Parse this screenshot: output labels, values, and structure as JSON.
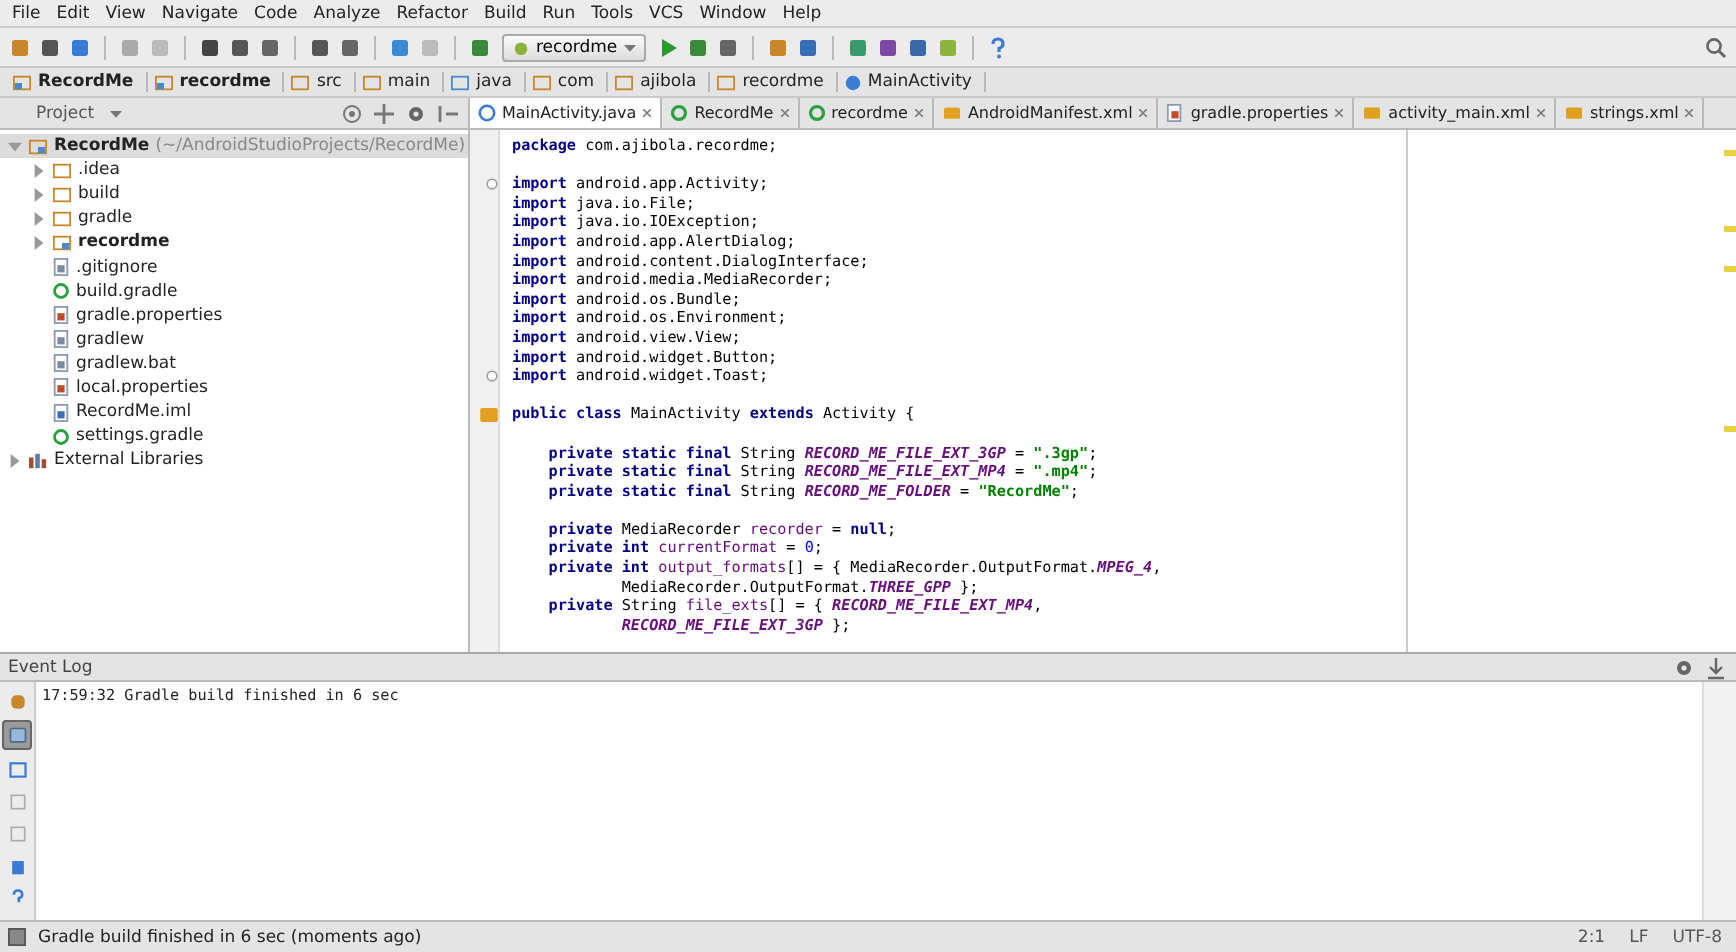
{
  "menu": [
    "File",
    "Edit",
    "View",
    "Navigate",
    "Code",
    "Analyze",
    "Refactor",
    "Build",
    "Run",
    "Tools",
    "VCS",
    "Window",
    "Help"
  ],
  "toolbar": {
    "run_config": "recordme"
  },
  "breadcrumbs": [
    {
      "label": "RecordMe",
      "kind": "module",
      "bold": true
    },
    {
      "label": "recordme",
      "kind": "module",
      "bold": true
    },
    {
      "label": "src",
      "kind": "folder",
      "bold": false
    },
    {
      "label": "main",
      "kind": "folder",
      "bold": false
    },
    {
      "label": "java",
      "kind": "source",
      "bold": false
    },
    {
      "label": "com",
      "kind": "package",
      "bold": false
    },
    {
      "label": "ajibola",
      "kind": "package",
      "bold": false
    },
    {
      "label": "recordme",
      "kind": "package",
      "bold": false
    },
    {
      "label": "MainActivity",
      "kind": "class",
      "bold": false
    }
  ],
  "project_panel": {
    "title": "Project",
    "tree": [
      {
        "label": "RecordMe",
        "note": "(~/AndroidStudioProjects/RecordMe)",
        "kind": "module",
        "bold": true,
        "expanded": true,
        "selected": true,
        "children": [
          {
            "label": ".idea",
            "kind": "folder",
            "bold": false,
            "expanded": false,
            "selected": false
          },
          {
            "label": "build",
            "kind": "folder",
            "bold": false,
            "expanded": false,
            "selected": false
          },
          {
            "label": "gradle",
            "kind": "folder",
            "bold": false,
            "expanded": false,
            "selected": false
          },
          {
            "label": "recordme",
            "kind": "module",
            "bold": true,
            "expanded": false,
            "selected": false
          },
          {
            "label": ".gitignore",
            "kind": "text",
            "bold": false,
            "selected": false
          },
          {
            "label": "build.gradle",
            "kind": "gradle",
            "bold": false,
            "selected": false
          },
          {
            "label": "gradle.properties",
            "kind": "props",
            "bold": false,
            "selected": false
          },
          {
            "label": "gradlew",
            "kind": "text",
            "bold": false,
            "selected": false
          },
          {
            "label": "gradlew.bat",
            "kind": "text",
            "bold": false,
            "selected": false
          },
          {
            "label": "local.properties",
            "kind": "props",
            "bold": false,
            "selected": false
          },
          {
            "label": "RecordMe.iml",
            "kind": "iml",
            "bold": false,
            "selected": false
          },
          {
            "label": "settings.gradle",
            "kind": "gradle",
            "bold": false,
            "selected": false
          }
        ]
      },
      {
        "label": "External Libraries",
        "kind": "libs",
        "bold": false,
        "expanded": false,
        "selected": false
      }
    ]
  },
  "editor_tabs": [
    {
      "label": "MainActivity.java",
      "kind": "class",
      "selected": true
    },
    {
      "label": "RecordMe",
      "kind": "gradle",
      "selected": false
    },
    {
      "label": "recordme",
      "kind": "gradle",
      "selected": false
    },
    {
      "label": "AndroidManifest.xml",
      "kind": "xml",
      "selected": false
    },
    {
      "label": "gradle.properties",
      "kind": "props",
      "selected": false
    },
    {
      "label": "activity_main.xml",
      "kind": "xml",
      "selected": false
    },
    {
      "label": "strings.xml",
      "kind": "xml",
      "selected": false
    }
  ],
  "code": [
    {
      "segments": [
        {
          "text": "package",
          "kind": "keyword"
        },
        {
          "text": " com.ajibola.recordme;",
          "kind": "plain"
        }
      ]
    },
    {
      "space_before": true,
      "fold": true,
      "segments": [
        {
          "text": "import",
          "kind": "keyword"
        },
        {
          "text": " android.app.Activity;",
          "kind": "plain"
        }
      ]
    },
    {
      "segments": [
        {
          "text": "import",
          "kind": "keyword"
        },
        {
          "text": " java.io.File;",
          "kind": "plain"
        }
      ]
    },
    {
      "segments": [
        {
          "text": "import",
          "kind": "keyword"
        },
        {
          "text": " java.io.IOException;",
          "kind": "plain"
        }
      ]
    },
    {
      "segments": [
        {
          "text": "import",
          "kind": "keyword"
        },
        {
          "text": " android.app.AlertDialog;",
          "kind": "plain"
        }
      ]
    },
    {
      "segments": [
        {
          "text": "import",
          "kind": "keyword"
        },
        {
          "text": " android.content.DialogInterface;",
          "kind": "plain"
        }
      ]
    },
    {
      "segments": [
        {
          "text": "import",
          "kind": "keyword"
        },
        {
          "text": " android.media.MediaRecorder;",
          "kind": "plain"
        }
      ]
    },
    {
      "segments": [
        {
          "text": "import",
          "kind": "keyword"
        },
        {
          "text": " android.os.Bundle;",
          "kind": "plain"
        }
      ]
    },
    {
      "segments": [
        {
          "text": "import",
          "kind": "keyword"
        },
        {
          "text": " android.os.Environment;",
          "kind": "plain"
        }
      ]
    },
    {
      "segments": [
        {
          "text": "import",
          "kind": "keyword"
        },
        {
          "text": " android.view.View;",
          "kind": "plain"
        }
      ]
    },
    {
      "segments": [
        {
          "text": "import",
          "kind": "keyword"
        },
        {
          "text": " android.widget.Button;",
          "kind": "plain"
        }
      ]
    },
    {
      "fold": true,
      "segments": [
        {
          "text": "import",
          "kind": "keyword"
        },
        {
          "text": " android.widget.Toast;",
          "kind": "plain"
        }
      ]
    },
    {
      "space_before": true,
      "marker": true,
      "segments": [
        {
          "text": "public class",
          "kind": "keyword"
        },
        {
          "text": " MainActivity ",
          "kind": "plain"
        },
        {
          "text": "extends",
          "kind": "keyword"
        },
        {
          "text": " Activity {",
          "kind": "plain"
        }
      ]
    },
    {
      "space_before": true,
      "segments": [
        {
          "text": "    private static final",
          "kind": "keyword"
        },
        {
          "text": " String ",
          "kind": "plain"
        },
        {
          "text": "RECORD_ME_FILE_EXT_3GP",
          "kind": "constant"
        },
        {
          "text": " = ",
          "kind": "plain"
        },
        {
          "text": "\".3gp\"",
          "kind": "string"
        },
        {
          "text": ";",
          "kind": "plain"
        }
      ]
    },
    {
      "segments": [
        {
          "text": "    private static final",
          "kind": "keyword"
        },
        {
          "text": " String ",
          "kind": "plain"
        },
        {
          "text": "RECORD_ME_FILE_EXT_MP4",
          "kind": "constant"
        },
        {
          "text": " = ",
          "kind": "plain"
        },
        {
          "text": "\".mp4\"",
          "kind": "string"
        },
        {
          "text": ";",
          "kind": "plain"
        }
      ]
    },
    {
      "segments": [
        {
          "text": "    private static final",
          "kind": "keyword"
        },
        {
          "text": " String ",
          "kind": "plain"
        },
        {
          "text": "RECORD_ME_FOLDER",
          "kind": "constant"
        },
        {
          "text": " = ",
          "kind": "plain"
        },
        {
          "text": "\"RecordMe\"",
          "kind": "string"
        },
        {
          "text": ";",
          "kind": "plain"
        }
      ]
    },
    {
      "space_before": true,
      "segments": [
        {
          "text": "    private",
          "kind": "keyword"
        },
        {
          "text": " MediaRecorder ",
          "kind": "plain"
        },
        {
          "text": "recorder",
          "kind": "field"
        },
        {
          "text": " = ",
          "kind": "plain"
        },
        {
          "text": "null",
          "kind": "keyword"
        },
        {
          "text": ";",
          "kind": "plain"
        }
      ]
    },
    {
      "segments": [
        {
          "text": "    private int ",
          "kind": "keyword"
        },
        {
          "text": "currentFormat",
          "kind": "field"
        },
        {
          "text": " = ",
          "kind": "plain"
        },
        {
          "text": "0",
          "kind": "number"
        },
        {
          "text": ";",
          "kind": "plain"
        }
      ]
    },
    {
      "segments": [
        {
          "text": "    private int ",
          "kind": "keyword"
        },
        {
          "text": "output_formats",
          "kind": "field"
        },
        {
          "text": "[] = { MediaRecorder.OutputFormat.",
          "kind": "plain"
        },
        {
          "text": "MPEG_4",
          "kind": "constant"
        },
        {
          "text": ",",
          "kind": "plain"
        }
      ]
    },
    {
      "segments": [
        {
          "text": "            MediaRecorder.OutputFormat.",
          "kind": "plain"
        },
        {
          "text": "THREE_GPP",
          "kind": "constant"
        },
        {
          "text": " };",
          "kind": "plain"
        }
      ]
    },
    {
      "segments": [
        {
          "text": "    private",
          "kind": "keyword"
        },
        {
          "text": " String ",
          "kind": "plain"
        },
        {
          "text": "file_exts",
          "kind": "field"
        },
        {
          "text": "[] = { ",
          "kind": "plain"
        },
        {
          "text": "RECORD_ME_FILE_EXT_MP4",
          "kind": "constant"
        },
        {
          "text": ",",
          "kind": "plain"
        }
      ]
    },
    {
      "segments": [
        {
          "text": "            RECORD_ME_FILE_EXT_3GP",
          "kind": "constant"
        },
        {
          "text": " };",
          "kind": "plain"
        }
      ]
    }
  ],
  "event_log": {
    "title": "Event Log",
    "tools": [
      {
        "kind": "settings",
        "selected": false
      },
      {
        "kind": "balloon",
        "selected": true
      },
      {
        "kind": "expand",
        "selected": false
      },
      {
        "kind": "scroll",
        "selected": false
      },
      {
        "kind": "mark",
        "selected": false
      },
      {
        "kind": "trash",
        "selected": false
      },
      {
        "kind": "help",
        "selected": false
      }
    ],
    "entries": [
      "17:59:32 Gradle build finished in 6 sec"
    ]
  },
  "status_bar": {
    "message": "Gradle build finished in 6 sec (moments ago)",
    "position": "2:1",
    "line_sep": "LF",
    "encoding": "UTF-8"
  }
}
